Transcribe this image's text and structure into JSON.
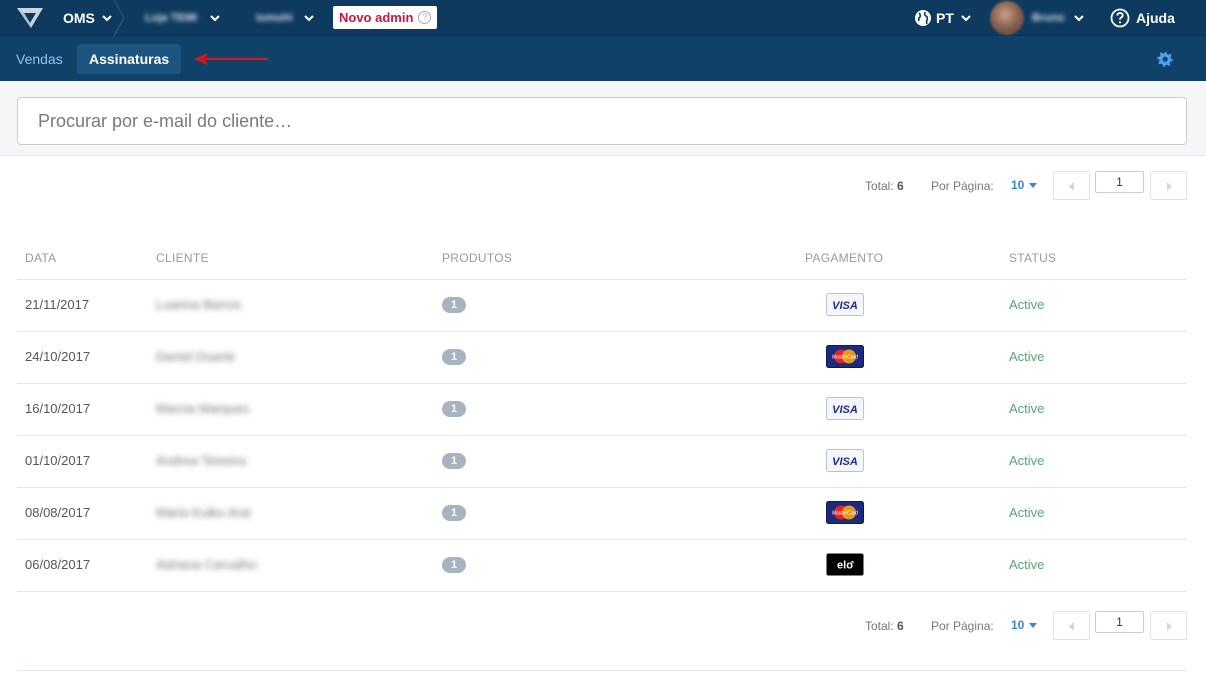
{
  "topnav": {
    "brand": "OMS",
    "store": "Loja TEMI",
    "user_context": "tomohi",
    "novo_admin": "Novo admin",
    "novo_admin_help": "?",
    "language": "PT",
    "user_name": "Bruno",
    "help": "Ajuda",
    "accent": "#0d3a5e"
  },
  "subnav": {
    "tabs": [
      {
        "label": "Vendas",
        "active": false
      },
      {
        "label": "Assinaturas",
        "active": true
      }
    ]
  },
  "search": {
    "placeholder": "Procurar por e-mail do cliente…"
  },
  "pager": {
    "total_label": "Total:",
    "total": "6",
    "per_page_label": "Por Página:",
    "per_page": "10",
    "page": "1"
  },
  "table": {
    "headers": [
      "DATA",
      "CLIENTE",
      "PRODUTOS",
      "PAGAMENTO",
      "STATUS"
    ],
    "rows": [
      {
        "date": "21/11/2017",
        "client": "Luanna Barros",
        "products": "1",
        "payment": "visa",
        "status": "Active"
      },
      {
        "date": "24/10/2017",
        "client": "Daniel Duarte",
        "products": "1",
        "payment": "mastercard",
        "status": "Active"
      },
      {
        "date": "16/10/2017",
        "client": "Marcia Marques",
        "products": "1",
        "payment": "visa",
        "status": "Active"
      },
      {
        "date": "01/10/2017",
        "client": "Andrea Teixeira",
        "products": "1",
        "payment": "visa",
        "status": "Active"
      },
      {
        "date": "08/08/2017",
        "client": "Maria Kulko Arai",
        "products": "1",
        "payment": "mastercard",
        "status": "Active"
      },
      {
        "date": "06/08/2017",
        "client": "Adriana Carvalho",
        "products": "1",
        "payment": "elo",
        "status": "Active"
      }
    ]
  },
  "card_labels": {
    "visa": "VISA",
    "mastercard": "MasterCard",
    "elo": "elo"
  },
  "colors": {
    "status_active": "#5aa374",
    "link": "#3a86c8",
    "novo_admin": "#d0133f"
  },
  "icons": {
    "logo": "vtex-logo-icon",
    "globe": "globe-icon",
    "help": "help-circle-icon",
    "gear": "gear-icon",
    "arrow": "red-arrow-annotation"
  }
}
